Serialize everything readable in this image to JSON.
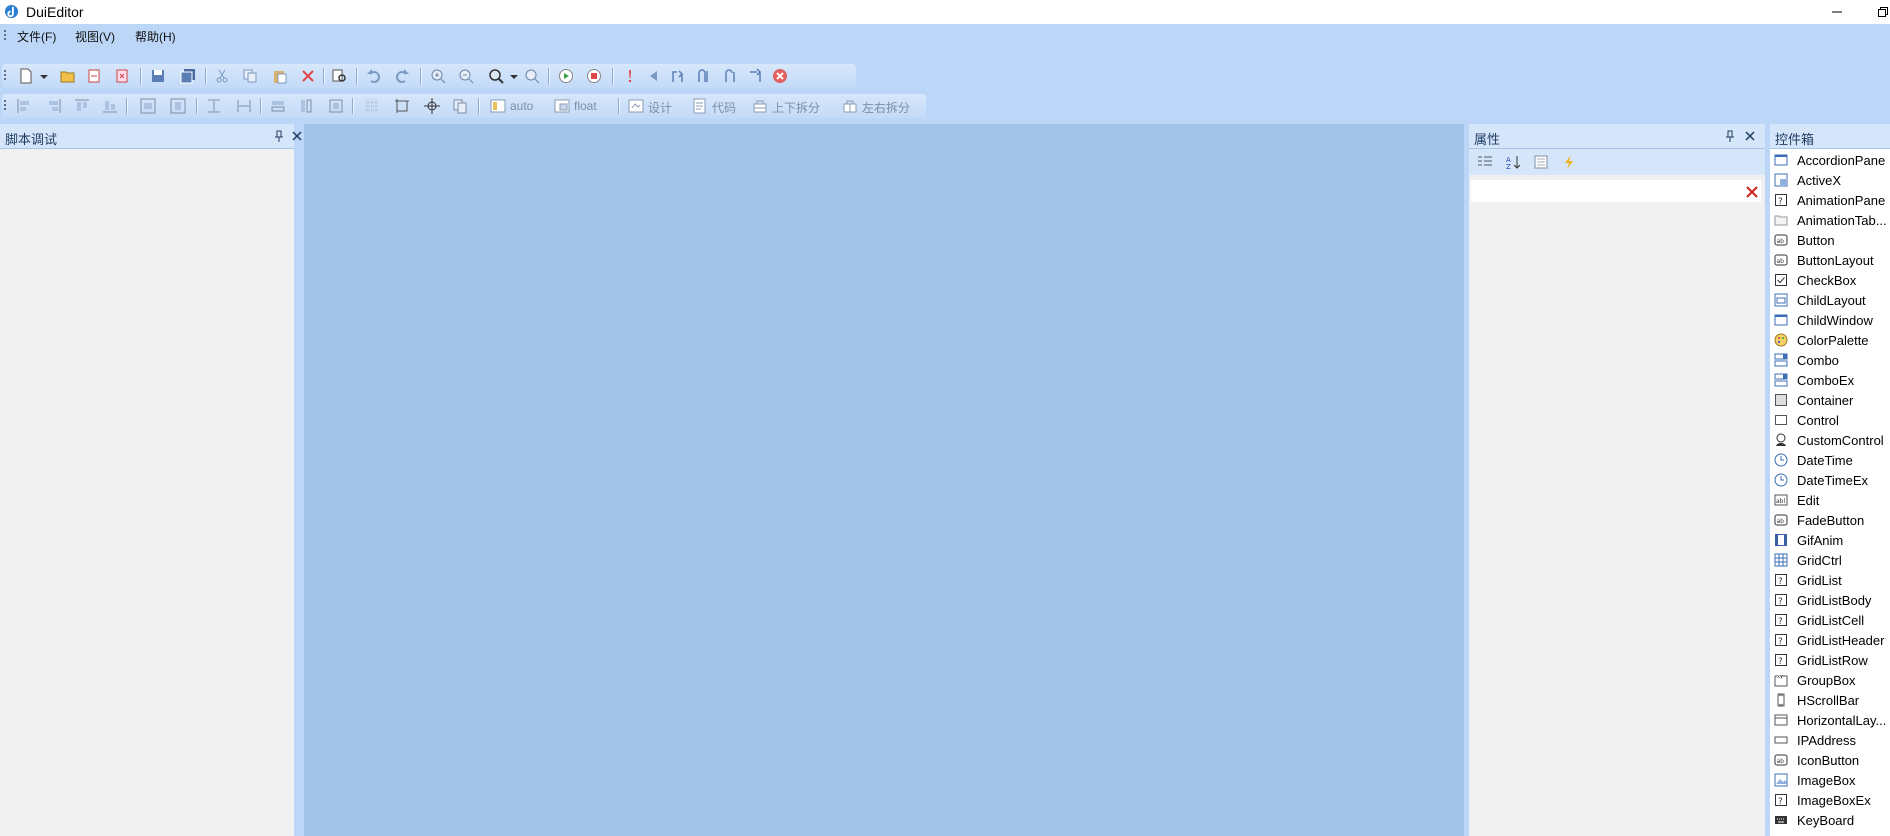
{
  "window": {
    "title": "DuiEditor"
  },
  "menu": [
    "文件(F)",
    "视图(V)",
    "帮助(H)"
  ],
  "toolbar2": {
    "auto_label": "auto",
    "float_label": "float",
    "design_label": "设计",
    "code_label": "代码",
    "split_v_label": "上下拆分",
    "split_h_label": "左右拆分"
  },
  "panels": {
    "script_debug": "脚本调试",
    "properties": "属性",
    "toolbox": "控件箱"
  },
  "toolbox_items": [
    {
      "label": "AccordionPane",
      "icon": "window-icon"
    },
    {
      "label": "ActiveX",
      "icon": "activex-icon"
    },
    {
      "label": "AnimationPane",
      "icon": "unknown-icon"
    },
    {
      "label": "AnimationTab...",
      "icon": "folder-icon"
    },
    {
      "label": "Button",
      "icon": "button-icon"
    },
    {
      "label": "ButtonLayout",
      "icon": "button-icon"
    },
    {
      "label": "CheckBox",
      "icon": "checkbox-icon"
    },
    {
      "label": "ChildLayout",
      "icon": "child-layout-icon"
    },
    {
      "label": "ChildWindow",
      "icon": "window-icon"
    },
    {
      "label": "ColorPalette",
      "icon": "palette-icon"
    },
    {
      "label": "Combo",
      "icon": "combo-icon"
    },
    {
      "label": "ComboEx",
      "icon": "combo-icon"
    },
    {
      "label": "Container",
      "icon": "container-icon"
    },
    {
      "label": "Control",
      "icon": "control-icon"
    },
    {
      "label": "CustomControl",
      "icon": "custom-control-icon"
    },
    {
      "label": "DateTime",
      "icon": "clock-icon"
    },
    {
      "label": "DateTimeEx",
      "icon": "clock-icon"
    },
    {
      "label": "Edit",
      "icon": "edit-icon"
    },
    {
      "label": "FadeButton",
      "icon": "button-icon"
    },
    {
      "label": "GifAnim",
      "icon": "film-icon"
    },
    {
      "label": "GridCtrl",
      "icon": "grid-icon"
    },
    {
      "label": "GridList",
      "icon": "unknown-icon"
    },
    {
      "label": "GridListBody",
      "icon": "unknown-icon"
    },
    {
      "label": "GridListCell",
      "icon": "unknown-icon"
    },
    {
      "label": "GridListHeader",
      "icon": "unknown-icon"
    },
    {
      "label": "GridListRow",
      "icon": "unknown-icon"
    },
    {
      "label": "GroupBox",
      "icon": "groupbox-icon"
    },
    {
      "label": "HScrollBar",
      "icon": "scrollbar-icon"
    },
    {
      "label": "HorizontalLay...",
      "icon": "horizontal-layout-icon"
    },
    {
      "label": "IPAddress",
      "icon": "ip-address-icon"
    },
    {
      "label": "IconButton",
      "icon": "button-icon"
    },
    {
      "label": "ImageBox",
      "icon": "image-icon"
    },
    {
      "label": "ImageBoxEx",
      "icon": "unknown-icon"
    },
    {
      "label": "KeyBoard",
      "icon": "keyboard-icon"
    }
  ]
}
